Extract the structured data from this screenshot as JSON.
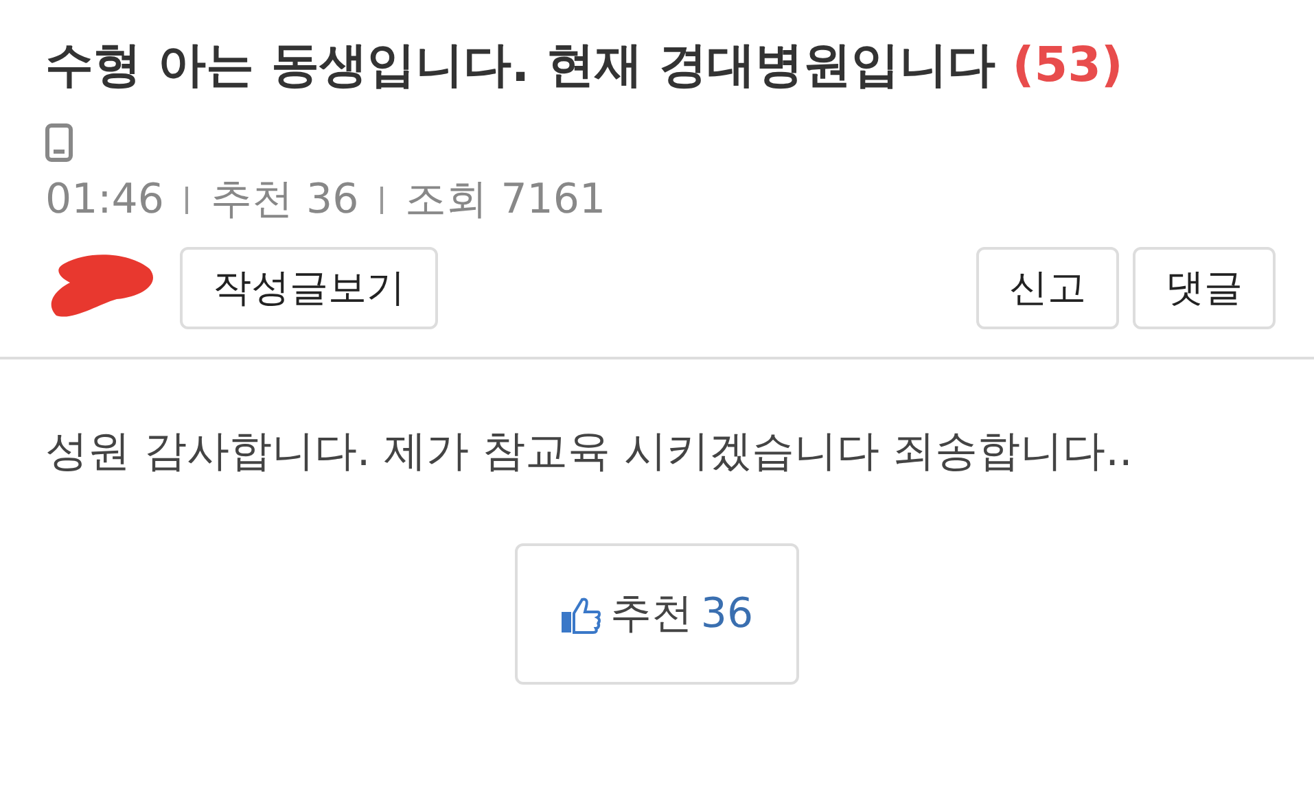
{
  "post": {
    "title": "수형 아는 동생입니다. 현재 경대병원입니다",
    "comment_count": "(53)",
    "meta": [
      "01:46",
      "추천 36",
      "조회 7161"
    ],
    "buttons": {
      "author_posts": "작성글보기",
      "report": "신고",
      "comment": "댓글"
    },
    "body": "성원 감사합니다. 제가 참교육 시키겠습니다 죄송합니다..",
    "like": {
      "label": "추천",
      "count": "36"
    }
  }
}
